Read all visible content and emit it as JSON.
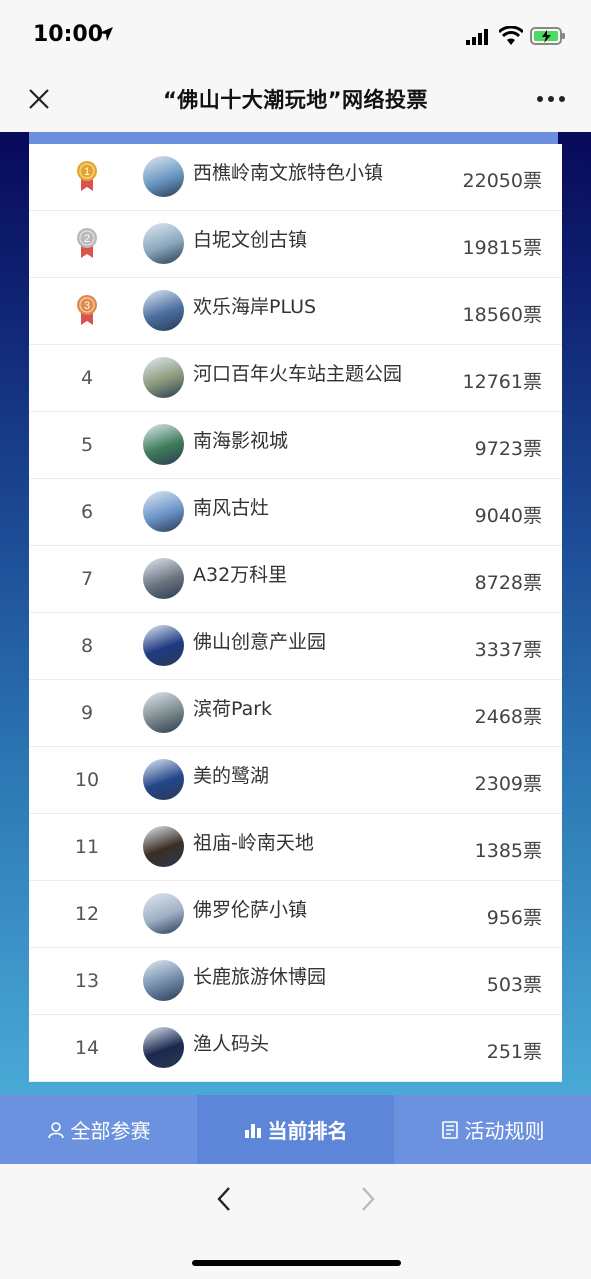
{
  "status": {
    "time": "10:00"
  },
  "nav": {
    "title": "“佛山十大潮玩地”网络投票"
  },
  "ranking": [
    {
      "rank": "",
      "medal": "gold",
      "name": "西樵岭南文旅特色小镇",
      "votes": "22050票",
      "color": "#6a98c2"
    },
    {
      "rank": "",
      "medal": "silver",
      "name": "白坭文创古镇",
      "votes": "19815票",
      "color": "#8aa8bc"
    },
    {
      "rank": "",
      "medal": "bronze",
      "name": "欢乐海岸PLUS",
      "votes": "18560票",
      "color": "#4a6fa0"
    },
    {
      "rank": "4",
      "name": "河口百年火车站主题公园",
      "votes": "12761票",
      "color": "#8c9a7a"
    },
    {
      "rank": "5",
      "name": "南海影视城",
      "votes": "9723票",
      "color": "#3f7d5a"
    },
    {
      "rank": "6",
      "name": "南风古灶",
      "votes": "9040票",
      "color": "#6b94c9"
    },
    {
      "rank": "7",
      "name": "A32万科里",
      "votes": "8728票",
      "color": "#6c7580"
    },
    {
      "rank": "8",
      "name": "佛山创意产业园",
      "votes": "3337票",
      "color": "#1f3a80"
    },
    {
      "rank": "9",
      "name": "滨荷Park",
      "votes": "2468票",
      "color": "#7c8a8a"
    },
    {
      "rank": "10",
      "name": "美的鹭湖",
      "votes": "2309票",
      "color": "#24468a"
    },
    {
      "rank": "11",
      "name": "祖庙-岭南天地",
      "votes": "1385票",
      "color": "#3a2e22"
    },
    {
      "rank": "12",
      "name": "佛罗伦萨小镇",
      "votes": "956票",
      "color": "#9fb0c4"
    },
    {
      "rank": "13",
      "name": "长鹿旅游休博园",
      "votes": "503票",
      "color": "#6f8aa8"
    },
    {
      "rank": "14",
      "name": "渔人码头",
      "votes": "251票",
      "color": "#1c2850"
    }
  ],
  "tabs": [
    {
      "label": "全部参赛",
      "icon": "person-icon"
    },
    {
      "label": "当前排名",
      "icon": "ranking-icon"
    },
    {
      "label": "活动规则",
      "icon": "document-icon"
    }
  ],
  "colors": {
    "accent": "#6c92df",
    "medal_gold": "#e3a62b",
    "medal_silver": "#b9b9b9",
    "medal_bronze": "#e08a4a"
  }
}
